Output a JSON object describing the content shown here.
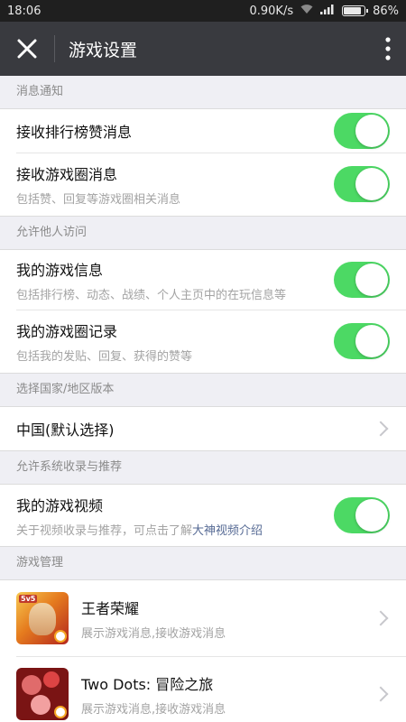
{
  "status_bar": {
    "time": "18:06",
    "speed": "0.90K/s",
    "battery": "86%"
  },
  "header": {
    "title": "游戏设置",
    "close_icon": "close-icon",
    "more_icon": "more-vertical-icon"
  },
  "sections": {
    "notify": {
      "header": "消息通知",
      "items": [
        {
          "title": "接收排行榜赞消息",
          "subtitle": ""
        },
        {
          "title": "接收游戏圈消息",
          "subtitle": "包括赞、回复等游戏圈相关消息"
        }
      ]
    },
    "visit": {
      "header": "允许他人访问",
      "items": [
        {
          "title": "我的游戏信息",
          "subtitle": "包括排行榜、动态、战绩、个人主页中的在玩信息等"
        },
        {
          "title": "我的游戏圈记录",
          "subtitle": "包括我的发贴、回复、获得的赞等"
        }
      ]
    },
    "region": {
      "header": "选择国家/地区版本",
      "item": {
        "title": "中国(默认选择)"
      }
    },
    "recommend": {
      "header": "允许系统收录与推荐",
      "item": {
        "title": "我的游戏视频",
        "subtitle_prefix": "关于视频收录与推荐，可点击了解",
        "subtitle_link": "大神视频介绍"
      }
    },
    "manage": {
      "header": "游戏管理",
      "games": [
        {
          "title": "王者荣耀",
          "subtitle": "展示游戏消息,接收游戏消息"
        },
        {
          "title": "Two Dots: 冒险之旅",
          "subtitle": "展示游戏消息,接收游戏消息"
        }
      ]
    }
  },
  "colors": {
    "toggle_on": "#4cd964",
    "app_bar": "#393a3f",
    "link": "#576b95"
  }
}
